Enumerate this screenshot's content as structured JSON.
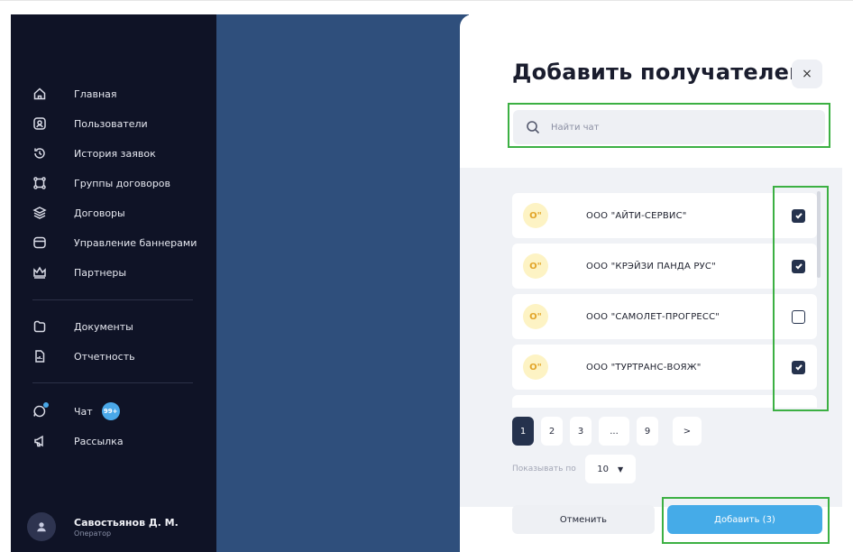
{
  "sidebar": {
    "items": [
      {
        "label": "Главная",
        "icon": "home-icon"
      },
      {
        "label": "Пользователи",
        "icon": "user-card-icon"
      },
      {
        "label": "История заявок",
        "icon": "history-icon"
      },
      {
        "label": "Группы договоров",
        "icon": "group-icon"
      },
      {
        "label": "Договоры",
        "icon": "layers-icon"
      },
      {
        "label": "Управление баннерами",
        "icon": "banner-icon"
      },
      {
        "label": "Партнеры",
        "icon": "crown-icon"
      },
      {
        "label": "Документы",
        "icon": "folder-icon"
      },
      {
        "label": "Отчетность",
        "icon": "report-icon"
      },
      {
        "label": "Чат",
        "icon": "chat-icon",
        "badge": "99+"
      },
      {
        "label": "Рассылка",
        "icon": "megaphone-icon"
      }
    ],
    "user": {
      "name": "Савостьянов Д. М.",
      "role": "Оператор"
    }
  },
  "modal": {
    "title": "Добавить получателей",
    "close_label": "×",
    "search": {
      "placeholder": "Найти чат",
      "value": ""
    },
    "recipients": [
      {
        "logo": "O\"",
        "name": "ООО \"АЙТИ-СЕРВИС\"",
        "checked": true
      },
      {
        "logo": "O\"",
        "name": "ООО \"КРЭЙЗИ ПАНДА РУС\"",
        "checked": true
      },
      {
        "logo": "O\"",
        "name": "ООО \"САМОЛЕТ-ПРОГРЕСС\"",
        "checked": false
      },
      {
        "logo": "O\"",
        "name": "ООО \"ТУРТРАНС-ВОЯЖ\"",
        "checked": true
      }
    ],
    "pagination": {
      "pages": [
        "1",
        "2",
        "3",
        "...",
        "9"
      ],
      "current": "1",
      "next": ">"
    },
    "per_page": {
      "label": "Показывать по",
      "value": "10"
    },
    "cancel_label": "Отменить",
    "add_label": "Добавить (3)"
  },
  "colors": {
    "sidebar_bg": "#0f1326",
    "accent": "#45abe8",
    "highlight": "#3cb043",
    "checkbox": "#25324d"
  }
}
